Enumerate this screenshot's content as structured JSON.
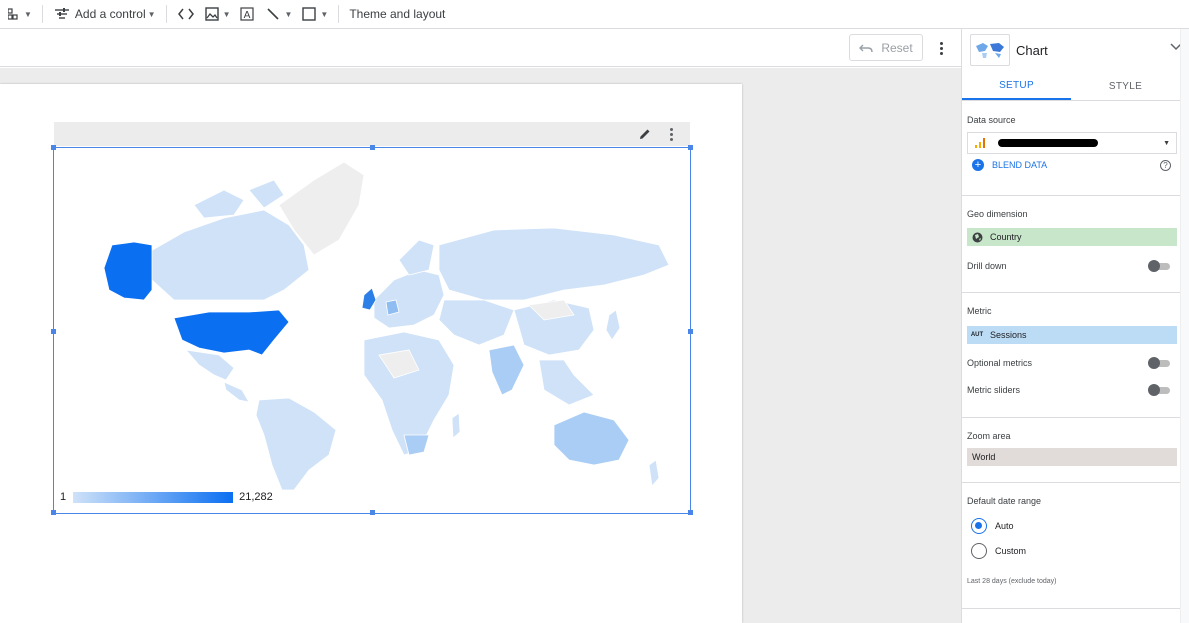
{
  "toolbar": {
    "add_control_label": "Add a control",
    "theme_layout_label": "Theme and layout"
  },
  "subbar": {
    "reset_label": "Reset"
  },
  "chart": {
    "legend_min": "1",
    "legend_max": "21,282",
    "colors": {
      "low": "#cfe2f8",
      "high": "#0b6ff2",
      "no_data": "#eeeeee"
    }
  },
  "chart_data": {
    "type": "geo",
    "geo_dimension": "Country",
    "metric": "Sessions",
    "color_scale": {
      "min": 1,
      "max": 21282
    },
    "highlighted": [
      {
        "region": "United States",
        "level": "high"
      },
      {
        "region": "United Kingdom",
        "level": "medium"
      },
      {
        "region": "India",
        "level": "medium-low"
      },
      {
        "region": "Australia",
        "level": "medium-low"
      }
    ]
  },
  "panel": {
    "title": "Chart",
    "tabs": [
      {
        "label": "SETUP",
        "active": true
      },
      {
        "label": "STYLE",
        "active": false
      }
    ],
    "data_source_label": "Data source",
    "blend_label": "BLEND DATA",
    "help_glyph": "?",
    "geo_dimension_label": "Geo dimension",
    "geo_dimension_value": "Country",
    "drill_down_label": "Drill down",
    "metric_label": "Metric",
    "metric_badge": "AUT",
    "metric_value": "Sessions",
    "optional_metrics_label": "Optional metrics",
    "metric_sliders_label": "Metric sliders",
    "zoom_area_label": "Zoom area",
    "zoom_area_value": "World",
    "date_range_label": "Default date range",
    "date_options": [
      {
        "label": "Auto",
        "selected": true
      },
      {
        "label": "Custom",
        "selected": false
      }
    ],
    "date_hint": "Last 28 days (exclude today)"
  }
}
